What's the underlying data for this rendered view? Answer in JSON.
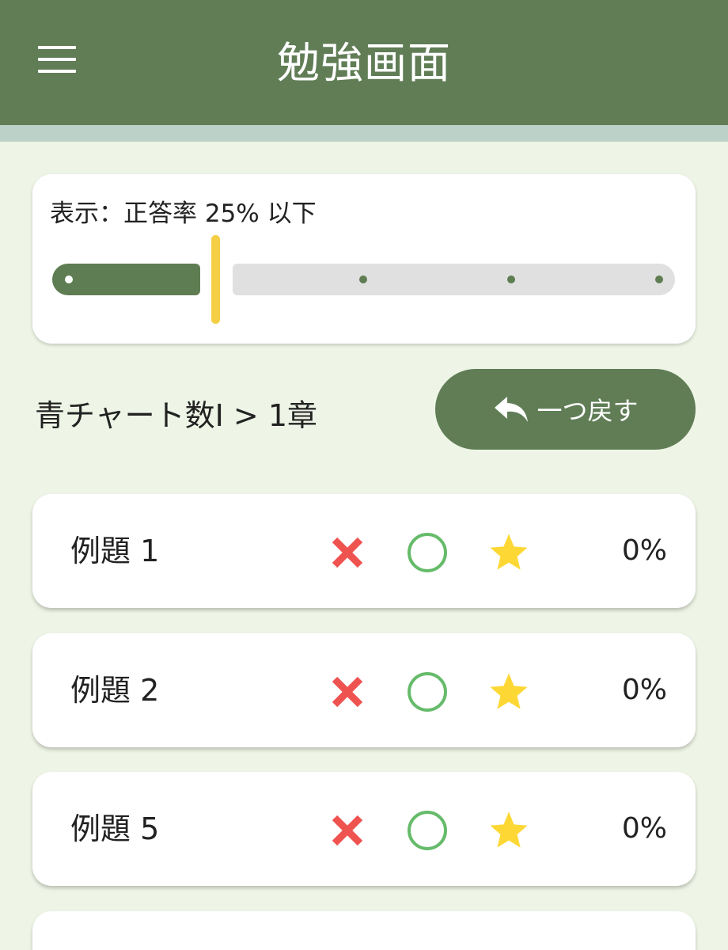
{
  "app_bar": {
    "title": "勉強画面",
    "menu_icon": "hamburger-menu-icon"
  },
  "filter": {
    "label": "表示：正答率 25% 以下",
    "threshold_percent": 25,
    "steps": [
      0,
      25,
      50,
      75,
      100
    ]
  },
  "breadcrumb": "青チャート数I > 1章",
  "undo_button": {
    "label": "一つ戻す",
    "icon": "reply-arrow-icon"
  },
  "questions": [
    {
      "name": "例題 1",
      "rate": "0%"
    },
    {
      "name": "例題 2",
      "rate": "0%"
    },
    {
      "name": "例題 5",
      "rate": "0%"
    },
    {
      "name": "",
      "rate": ""
    }
  ],
  "colors": {
    "primary": "#607d56",
    "accent_thumb": "#f4cf45",
    "wrong": "#ef5350",
    "correct": "#66bb6a",
    "star": "#fdd835",
    "background": "#eef5e6"
  }
}
